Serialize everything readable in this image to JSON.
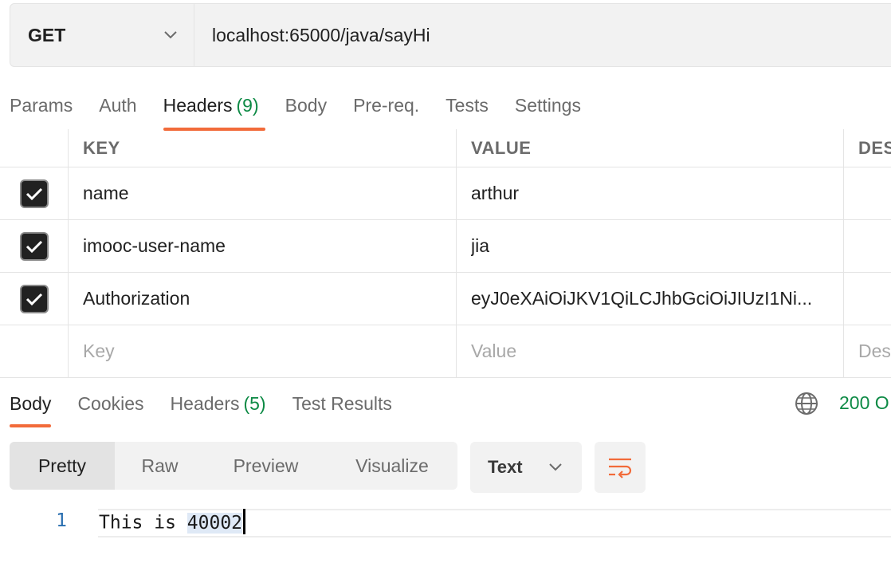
{
  "request": {
    "method": "GET",
    "url": "localhost:65000/java/sayHi"
  },
  "request_tabs": [
    {
      "label": "Params",
      "count": ""
    },
    {
      "label": "Auth",
      "count": ""
    },
    {
      "label": "Headers",
      "count": "(9)",
      "active": true
    },
    {
      "label": "Body",
      "count": ""
    },
    {
      "label": "Pre-req.",
      "count": ""
    },
    {
      "label": "Tests",
      "count": ""
    },
    {
      "label": "Settings",
      "count": ""
    }
  ],
  "headers_table": {
    "columns": {
      "key": "KEY",
      "value": "VALUE",
      "description": "DES"
    },
    "rows": [
      {
        "checked": true,
        "key": "name",
        "value": "arthur"
      },
      {
        "checked": true,
        "key": "imooc-user-name",
        "value": "jia"
      },
      {
        "checked": true,
        "key": "Authorization",
        "value": "eyJ0eXAiOiJKV1QiLCJhbGciOiJIUzI1Ni..."
      }
    ],
    "placeholders": {
      "key": "Key",
      "value": "Value",
      "description": "Des"
    }
  },
  "response_tabs": [
    {
      "label": "Body",
      "count": "",
      "active": true
    },
    {
      "label": "Cookies",
      "count": ""
    },
    {
      "label": "Headers",
      "count": "(5)"
    },
    {
      "label": "Test Results",
      "count": ""
    }
  ],
  "response_status": "200 O",
  "view_modes": [
    "Pretty",
    "Raw",
    "Preview",
    "Visualize"
  ],
  "active_view_mode": "Pretty",
  "body_language": "Text",
  "editor": {
    "line_number": "1",
    "text_before": "This is ",
    "text_selected": "40002"
  },
  "colors": {
    "accent": "#f26b3a",
    "success": "#0d8a45",
    "line_number": "#2a6fb0"
  }
}
